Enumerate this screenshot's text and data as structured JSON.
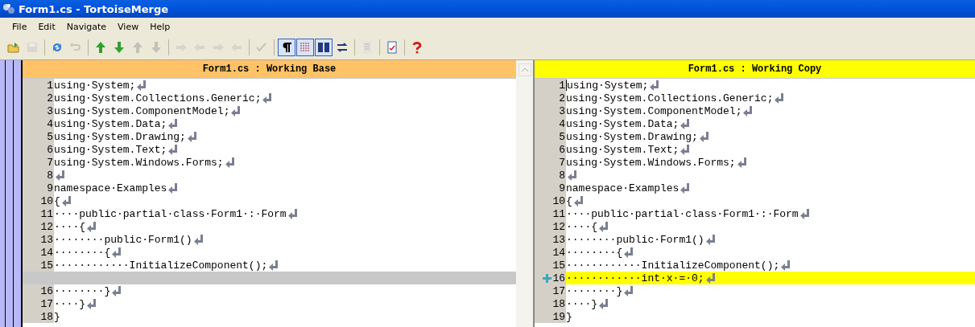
{
  "window": {
    "title": "Form1.cs - TortoiseMerge"
  },
  "menu": [
    {
      "label": "File"
    },
    {
      "label": "Edit"
    },
    {
      "label": "Navigate"
    },
    {
      "label": "View"
    },
    {
      "label": "Help"
    }
  ],
  "toolbar": [
    {
      "kind": "open",
      "disabled": false,
      "on": false
    },
    {
      "kind": "save",
      "disabled": true,
      "on": false
    },
    {
      "kind": "sep"
    },
    {
      "kind": "reload",
      "disabled": false,
      "on": false
    },
    {
      "kind": "undo",
      "disabled": true,
      "on": false
    },
    {
      "kind": "sep"
    },
    {
      "kind": "up",
      "disabled": false,
      "on": false
    },
    {
      "kind": "down",
      "disabled": false,
      "on": false
    },
    {
      "kind": "up",
      "disabled": true,
      "on": false
    },
    {
      "kind": "down",
      "disabled": true,
      "on": false
    },
    {
      "kind": "sep"
    },
    {
      "kind": "right",
      "disabled": true,
      "on": false
    },
    {
      "kind": "left",
      "disabled": true,
      "on": false
    },
    {
      "kind": "right",
      "disabled": true,
      "on": false
    },
    {
      "kind": "left",
      "disabled": true,
      "on": false
    },
    {
      "kind": "sep"
    },
    {
      "kind": "mark",
      "disabled": true,
      "on": false
    },
    {
      "kind": "sep"
    },
    {
      "kind": "pilcrow",
      "disabled": false,
      "on": true
    },
    {
      "kind": "whitespace",
      "disabled": false,
      "on": true
    },
    {
      "kind": "panes",
      "disabled": false,
      "on": true
    },
    {
      "kind": "swap",
      "disabled": false,
      "on": false
    },
    {
      "kind": "sep"
    },
    {
      "kind": "lines",
      "disabled": true,
      "on": false
    },
    {
      "kind": "sep"
    },
    {
      "kind": "report",
      "disabled": false,
      "on": false
    },
    {
      "kind": "sep"
    },
    {
      "kind": "help",
      "disabled": false,
      "on": false
    }
  ],
  "panes": [
    {
      "title": "Form1.cs : Working Base",
      "color": "#ffc266",
      "cursor": false,
      "lines": [
        {
          "kind": "normal",
          "number": "1",
          "text": "using·System;"
        },
        {
          "kind": "normal",
          "number": "2",
          "text": "using·System.Collections.Generic;"
        },
        {
          "kind": "normal",
          "number": "3",
          "text": "using·System.ComponentModel;"
        },
        {
          "kind": "normal",
          "number": "4",
          "text": "using·System.Data;"
        },
        {
          "kind": "normal",
          "number": "5",
          "text": "using·System.Drawing;"
        },
        {
          "kind": "normal",
          "number": "6",
          "text": "using·System.Text;"
        },
        {
          "kind": "normal",
          "number": "7",
          "text": "using·System.Windows.Forms;"
        },
        {
          "kind": "normal",
          "number": "8"
        },
        {
          "kind": "normal",
          "number": "9",
          "text": "namespace·Examples"
        },
        {
          "kind": "normal",
          "number": "10",
          "text": "{"
        },
        {
          "kind": "normal",
          "number": "11",
          "text": "····public·partial·class·Form1·:·Form"
        },
        {
          "kind": "normal",
          "number": "12",
          "text": "····{"
        },
        {
          "kind": "normal",
          "number": "13",
          "text": "········public·Form1()"
        },
        {
          "kind": "normal",
          "number": "14",
          "text": "········{"
        },
        {
          "kind": "normal",
          "number": "15",
          "text": "············InitializeComponent();"
        },
        {
          "kind": "empty"
        },
        {
          "kind": "normal",
          "number": "16",
          "text": "········}"
        },
        {
          "kind": "normal",
          "number": "17",
          "text": "····}"
        },
        {
          "kind": "last",
          "number": "18",
          "text": "}"
        }
      ]
    },
    {
      "title": "Form1.cs : Working Copy",
      "color": "#ffff00",
      "cursor": true,
      "lines": [
        {
          "kind": "normal",
          "number": "1",
          "text": "using·System;"
        },
        {
          "kind": "normal",
          "number": "2",
          "text": "using·System.Collections.Generic;"
        },
        {
          "kind": "normal",
          "number": "3",
          "text": "using·System.ComponentModel;"
        },
        {
          "kind": "normal",
          "number": "4",
          "text": "using·System.Data;"
        },
        {
          "kind": "normal",
          "number": "5",
          "text": "using·System.Drawing;"
        },
        {
          "kind": "normal",
          "number": "6",
          "text": "using·System.Text;"
        },
        {
          "kind": "normal",
          "number": "7",
          "text": "using·System.Windows.Forms;"
        },
        {
          "kind": "normal",
          "number": "8"
        },
        {
          "kind": "normal",
          "number": "9",
          "text": "namespace·Examples"
        },
        {
          "kind": "normal",
          "number": "10",
          "text": "{"
        },
        {
          "kind": "normal",
          "number": "11",
          "text": "····public·partial·class·Form1·:·Form"
        },
        {
          "kind": "normal",
          "number": "12",
          "text": "····{"
        },
        {
          "kind": "normal",
          "number": "13",
          "text": "········public·Form1()"
        },
        {
          "kind": "normal",
          "number": "14",
          "text": "········{"
        },
        {
          "kind": "normal",
          "number": "15",
          "text": "············InitializeComponent();"
        },
        {
          "kind": "added",
          "number": "16",
          "text": "············int·x·=·0;"
        },
        {
          "kind": "normal",
          "number": "17",
          "text": "········}"
        },
        {
          "kind": "normal",
          "number": "18",
          "text": "····}"
        },
        {
          "kind": "last",
          "number": "19",
          "text": "}"
        }
      ]
    }
  ]
}
